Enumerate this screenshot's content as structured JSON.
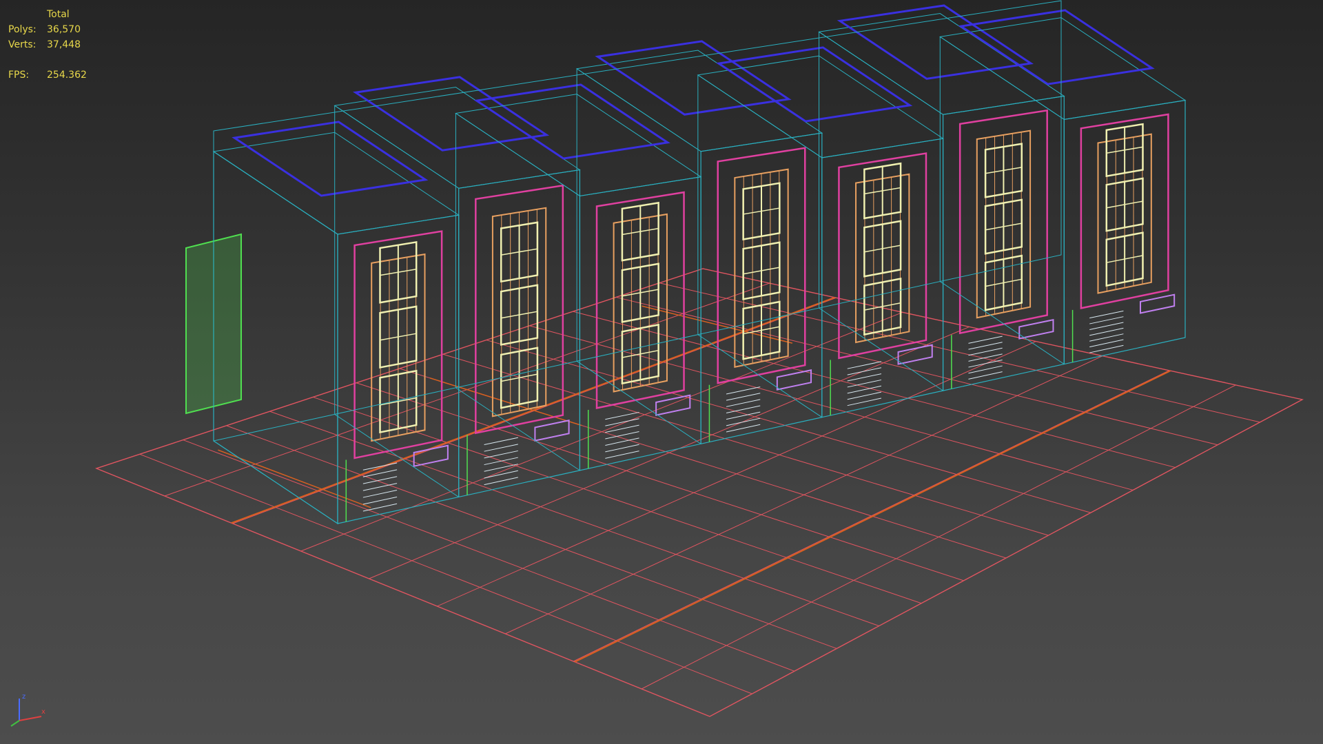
{
  "viewport": {
    "stats": {
      "header": "Total",
      "polys_label": "Polys:",
      "polys_value": "36,570",
      "verts_label": "Verts:",
      "verts_value": "37,448",
      "fps_label": "FPS:",
      "fps_value": "254.362"
    },
    "view_mode": "wireframe",
    "colors": {
      "background_top": "#252525",
      "background_bottom": "#4d4d4d",
      "stats_text": "#e8d84a",
      "ground_grid": "#e05560",
      "road_lines": "#d86020",
      "cyan_wire": "#2ab0c0",
      "blue_wire": "#3a30e0",
      "pink_wire": "#e040a0",
      "orange_wire": "#e8a060",
      "yellow_wire": "#f0f0b0",
      "green_wire": "#50e050",
      "violet_wire": "#c080f0"
    },
    "axis_gizmo": {
      "z_label": "z",
      "x_label": "x",
      "y_label": "y",
      "icon": "axis-tripod-icon"
    }
  }
}
